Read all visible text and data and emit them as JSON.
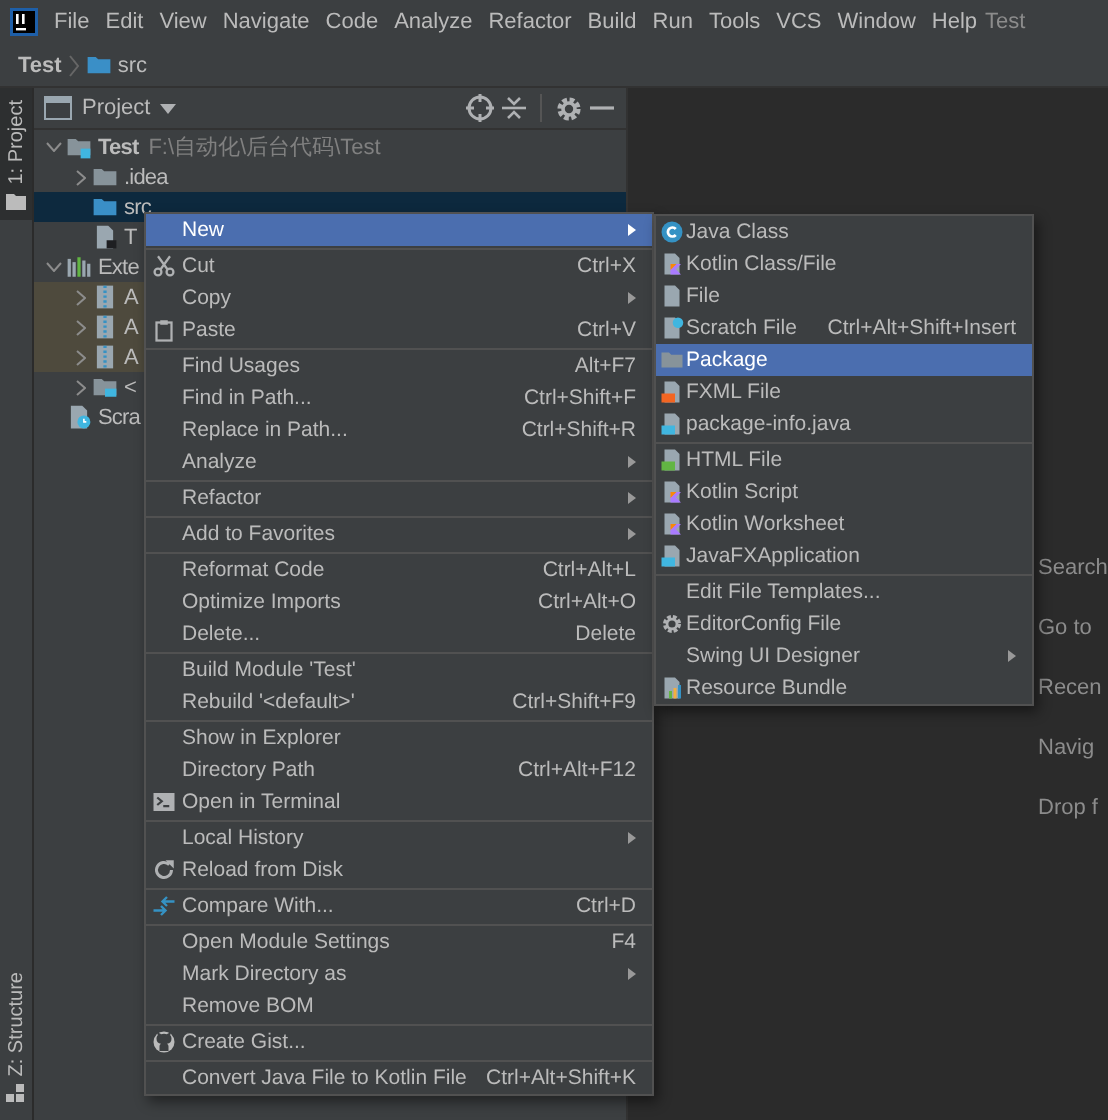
{
  "menubar": {
    "items": [
      "File",
      "Edit",
      "View",
      "Navigate",
      "Code",
      "Analyze",
      "Refactor",
      "Build",
      "Run",
      "Tools",
      "VCS",
      "Window",
      "Help"
    ],
    "project": "Test"
  },
  "breadcrumb": [
    {
      "label": "Test",
      "kind": "project"
    },
    {
      "label": "src",
      "kind": "folder"
    }
  ],
  "stripe": {
    "top": {
      "label": "1: Project",
      "selected": true
    },
    "bottom": {
      "label": "Z: Structure",
      "selected": false
    }
  },
  "project_panel": {
    "title": "Project",
    "tree": [
      {
        "label": "Test",
        "kind": "module",
        "path": "F:\\自动化\\后台代码\\Test",
        "expanded": true,
        "selected": false,
        "children": [
          {
            "label": ".idea",
            "kind": "folder",
            "expanded": false,
            "selected": false
          },
          {
            "label": "src",
            "kind": "folder",
            "selected": true
          },
          {
            "label": "T",
            "kind": "file",
            "selected": false
          }
        ]
      },
      {
        "label": "Exte",
        "kind": "libraries",
        "expanded": true,
        "selected": false,
        "children": [
          {
            "label": "A",
            "kind": "jar",
            "expanded": false,
            "selected": false,
            "highlighted": true
          },
          {
            "label": "A",
            "kind": "jar",
            "expanded": false,
            "selected": false,
            "highlighted": true
          },
          {
            "label": "A",
            "kind": "jar",
            "expanded": false,
            "selected": false,
            "highlighted": true
          },
          {
            "label": "<",
            "kind": "jdk",
            "expanded": false,
            "selected": false,
            "highlighted": false
          }
        ]
      },
      {
        "label": "Scra",
        "kind": "scratch",
        "selected": false
      }
    ]
  },
  "context_menu": {
    "groups": [
      {
        "items": [
          {
            "label": "New",
            "submenu": true,
            "selected": true
          }
        ]
      },
      {
        "items": [
          {
            "label": "Cut",
            "shortcut": "Ctrl+X",
            "kind": "cut",
            "selected": false
          },
          {
            "label": "Copy",
            "submenu": true,
            "selected": false
          },
          {
            "label": "Paste",
            "shortcut": "Ctrl+V",
            "kind": "paste",
            "selected": false
          }
        ]
      },
      {
        "items": [
          {
            "label": "Find Usages",
            "shortcut": "Alt+F7",
            "selected": false
          },
          {
            "label": "Find in Path...",
            "shortcut": "Ctrl+Shift+F",
            "selected": false
          },
          {
            "label": "Replace in Path...",
            "shortcut": "Ctrl+Shift+R",
            "selected": false
          },
          {
            "label": "Analyze",
            "submenu": true,
            "selected": false
          }
        ]
      },
      {
        "items": [
          {
            "label": "Refactor",
            "submenu": true,
            "selected": false
          }
        ]
      },
      {
        "items": [
          {
            "label": "Add to Favorites",
            "submenu": true,
            "selected": false
          }
        ]
      },
      {
        "items": [
          {
            "label": "Reformat Code",
            "shortcut": "Ctrl+Alt+L",
            "selected": false
          },
          {
            "label": "Optimize Imports",
            "shortcut": "Ctrl+Alt+O",
            "selected": false
          },
          {
            "label": "Delete...",
            "shortcut": "Delete",
            "selected": false
          }
        ]
      },
      {
        "items": [
          {
            "label": "Build Module 'Test'",
            "selected": false
          },
          {
            "label": "Rebuild '<default>'",
            "shortcut": "Ctrl+Shift+F9",
            "selected": false
          }
        ]
      },
      {
        "items": [
          {
            "label": "Show in Explorer",
            "selected": false
          },
          {
            "label": "Directory Path",
            "shortcut": "Ctrl+Alt+F12",
            "selected": false
          },
          {
            "label": "Open in Terminal",
            "kind": "terminal",
            "selected": false
          }
        ]
      },
      {
        "items": [
          {
            "label": "Local History",
            "submenu": true,
            "selected": false
          },
          {
            "label": "Reload from Disk",
            "kind": "reload",
            "selected": false
          }
        ]
      },
      {
        "items": [
          {
            "label": "Compare With...",
            "shortcut": "Ctrl+D",
            "kind": "compare",
            "selected": false
          }
        ]
      },
      {
        "items": [
          {
            "label": "Open Module Settings",
            "shortcut": "F4",
            "selected": false
          },
          {
            "label": "Mark Directory as",
            "submenu": true,
            "selected": false
          },
          {
            "label": "Remove BOM",
            "selected": false
          }
        ]
      },
      {
        "items": [
          {
            "label": "Create Gist...",
            "kind": "gist",
            "selected": false
          }
        ]
      },
      {
        "items": [
          {
            "label": "Convert Java File to Kotlin File",
            "shortcut": "Ctrl+Alt+Shift+K",
            "selected": false
          }
        ]
      }
    ]
  },
  "submenu": {
    "groups": [
      {
        "items": [
          {
            "label": "Java Class",
            "kind": "class",
            "selected": false
          },
          {
            "label": "Kotlin Class/File",
            "kind": "kotlin",
            "selected": false
          },
          {
            "label": "File",
            "kind": "file",
            "selected": false
          },
          {
            "label": "Scratch File",
            "shortcut": "Ctrl+Alt+Shift+Insert",
            "kind": "scratch",
            "selected": false
          },
          {
            "label": "Package",
            "kind": "package",
            "selected": true
          },
          {
            "label": "FXML File",
            "kind": "fxml",
            "selected": false
          },
          {
            "label": "package-info.java",
            "kind": "javafile",
            "selected": false
          }
        ]
      },
      {
        "items": [
          {
            "label": "HTML File",
            "kind": "html",
            "selected": false
          },
          {
            "label": "Kotlin Script",
            "kind": "kotlin",
            "selected": false
          },
          {
            "label": "Kotlin Worksheet",
            "kind": "kotlin",
            "selected": false
          },
          {
            "label": "JavaFXApplication",
            "kind": "javafile",
            "selected": false
          }
        ]
      },
      {
        "items": [
          {
            "label": "Edit File Templates...",
            "selected": false
          },
          {
            "label": "EditorConfig File",
            "kind": "editorconfig",
            "selected": false
          },
          {
            "label": "Swing UI Designer",
            "submenu": true,
            "selected": false
          },
          {
            "label": "Resource Bundle",
            "kind": "bundle",
            "selected": false
          }
        ]
      }
    ]
  },
  "editor": {
    "hints": [
      "Search",
      "Go to",
      "Recen",
      "Navig",
      "Drop f"
    ]
  }
}
